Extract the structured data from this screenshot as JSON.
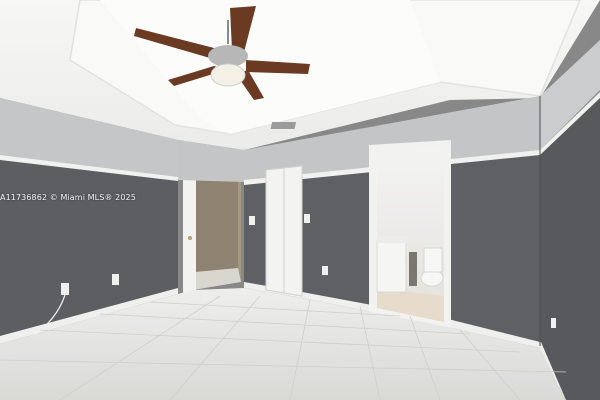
{
  "photo": {
    "watermark": "A11736862 © Miami MLS® 2025"
  },
  "colors": {
    "wall_gray": "#5f6064",
    "wall_upper": "#c8c9cb",
    "ceiling": "#f4f4f2",
    "floor_tile": "#e4e4e1",
    "trim_white": "#f3f3f1"
  }
}
